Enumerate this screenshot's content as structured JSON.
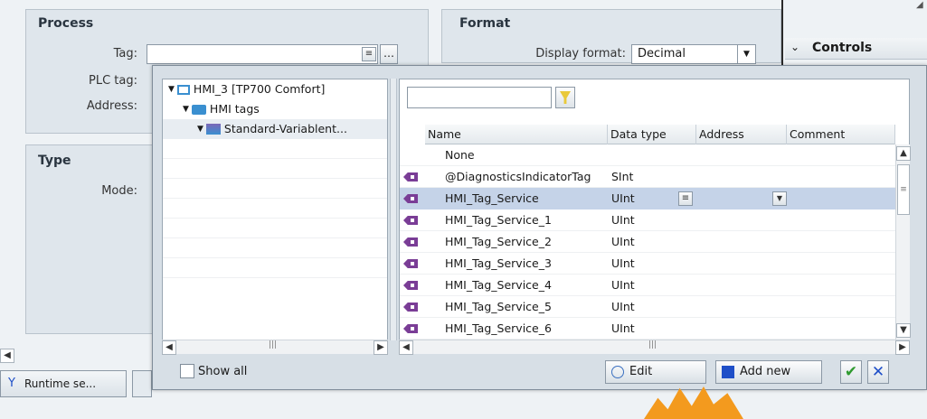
{
  "process": {
    "title": "Process",
    "tag_label": "Tag:",
    "plc_tag_label": "PLC tag:",
    "address_label": "Address:"
  },
  "format": {
    "title": "Format",
    "display_format_label": "Display format:",
    "display_format_value": "Decimal"
  },
  "controls": {
    "title": "Controls"
  },
  "type_panel": {
    "title": "Type",
    "mode_label": "Mode:"
  },
  "bottom": {
    "runtime_tab": "Runtime se..."
  },
  "dialog": {
    "tree": [
      {
        "label": "HMI_3 [TP700 Comfort]",
        "level": 0
      },
      {
        "label": "HMI tags",
        "level": 1
      },
      {
        "label": "Standard-Variablent...",
        "level": 2
      }
    ],
    "filter_value": "",
    "columns": [
      "Name",
      "Data type",
      "Address",
      "Comment"
    ],
    "rows": [
      {
        "name": "None",
        "type": "",
        "icon": false,
        "selected": false
      },
      {
        "name": "@DiagnosticsIndicatorTag",
        "type": "SInt",
        "icon": true,
        "selected": false
      },
      {
        "name": "HMI_Tag_Service",
        "type": "UInt",
        "icon": true,
        "selected": true
      },
      {
        "name": "HMI_Tag_Service_1",
        "type": "UInt",
        "icon": true,
        "selected": false
      },
      {
        "name": "HMI_Tag_Service_2",
        "type": "UInt",
        "icon": true,
        "selected": false
      },
      {
        "name": "HMI_Tag_Service_3",
        "type": "UInt",
        "icon": true,
        "selected": false
      },
      {
        "name": "HMI_Tag_Service_4",
        "type": "UInt",
        "icon": true,
        "selected": false
      },
      {
        "name": "HMI_Tag_Service_5",
        "type": "UInt",
        "icon": true,
        "selected": false
      },
      {
        "name": "HMI_Tag_Service_6",
        "type": "UInt",
        "icon": true,
        "selected": false
      }
    ],
    "show_all_label": "Show all",
    "edit_label": "Edit",
    "add_new_label": "Add new",
    "ok_symbol": "✔",
    "cancel_symbol": "✕"
  },
  "colors": {
    "selected_row": "#c5d3e8",
    "accent_green": "#2f9a2f",
    "accent_blue": "#1f4fc8",
    "tag_icon": "#7a3d96",
    "folder": "#3a8fd0"
  }
}
